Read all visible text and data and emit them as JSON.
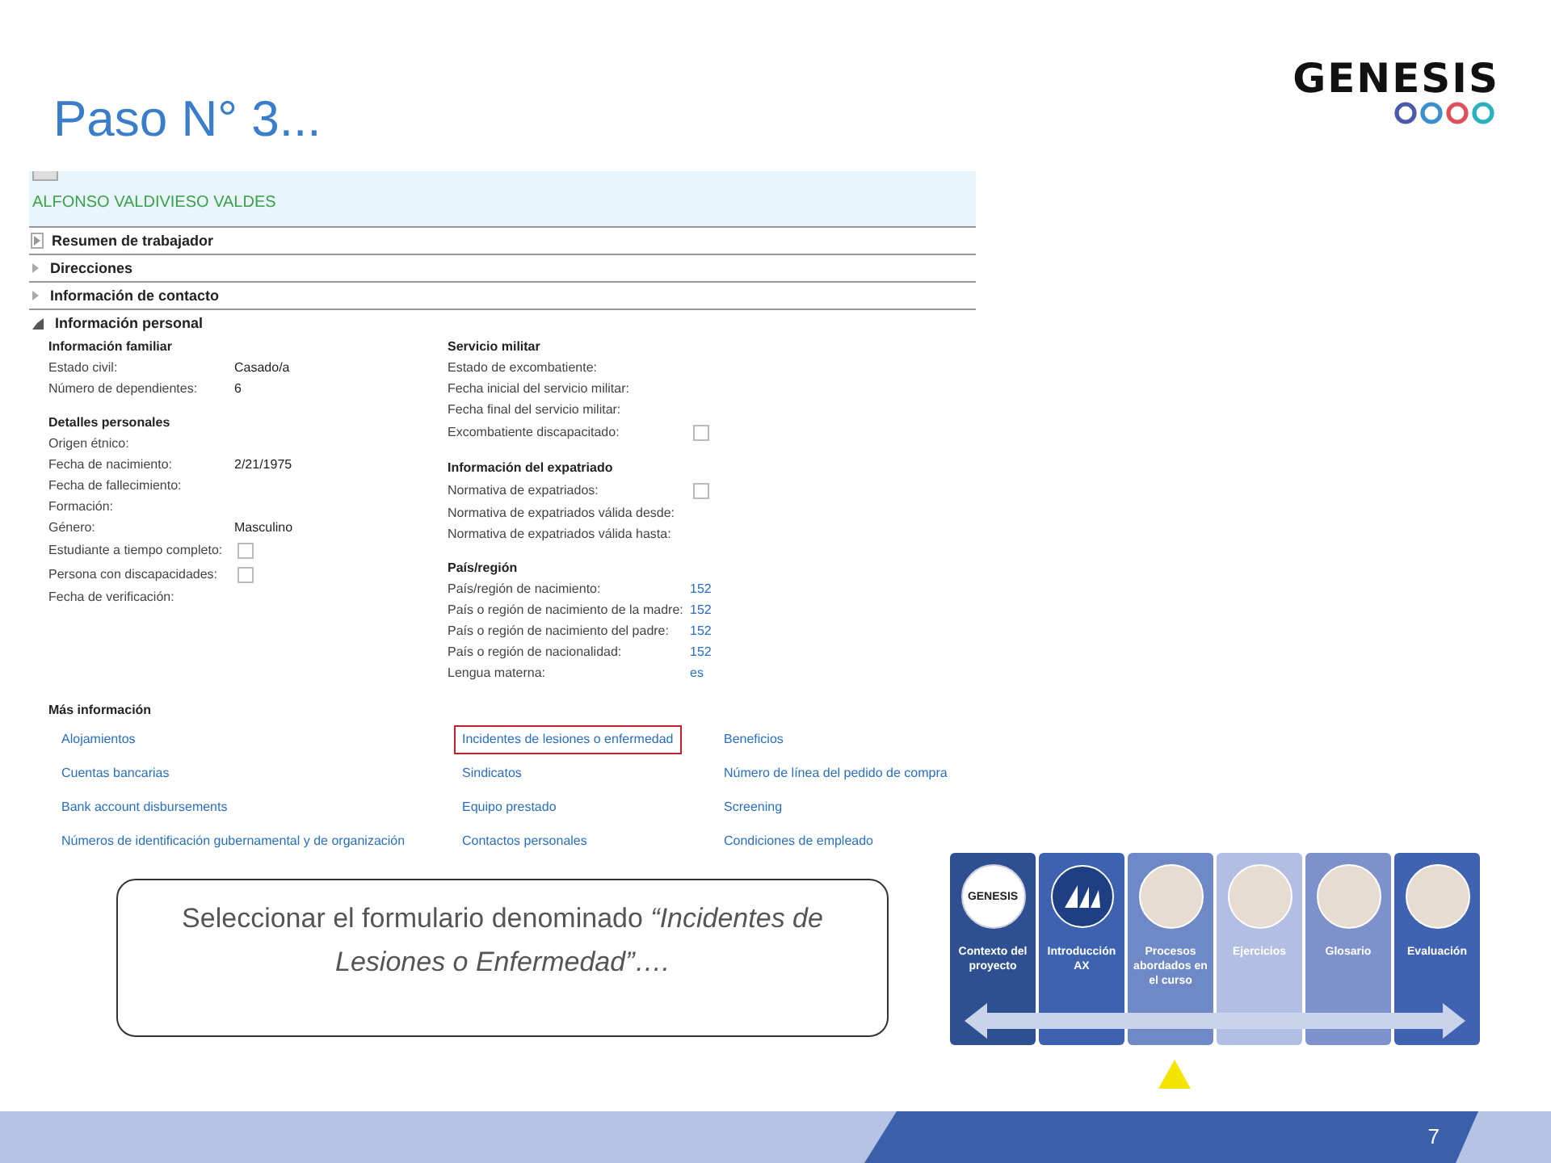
{
  "slide": {
    "title": "Paso N° 3...",
    "page_number": "7"
  },
  "logo": {
    "text": "GENESIS",
    "rings": [
      {
        "color": "#4a5aa8"
      },
      {
        "color": "#3a8fd0"
      },
      {
        "color": "#e0505a"
      },
      {
        "color": "#2ab0c0"
      }
    ]
  },
  "form": {
    "record_name": "ALFONSO VALDIVIESO VALDES",
    "sections": [
      {
        "label": "Resumen de trabajador",
        "kind": "preview",
        "expanded": false
      },
      {
        "label": "Direcciones",
        "kind": "fasttab",
        "expanded": false
      },
      {
        "label": "Información de contacto",
        "kind": "fasttab",
        "expanded": false
      },
      {
        "label": "Información personal",
        "kind": "fasttab",
        "expanded": true
      }
    ],
    "columns": [
      [
        {
          "heading": "Información familiar",
          "fields": [
            {
              "label": "Estado civil:",
              "kind": "text",
              "value": "Casado/a"
            },
            {
              "label": "Número de dependientes:",
              "kind": "text",
              "value": "6"
            }
          ]
        },
        {
          "heading": "Detalles personales",
          "fields": [
            {
              "label": "Origen étnico:",
              "kind": "text"
            },
            {
              "label": "Fecha de nacimiento:",
              "kind": "text",
              "value": "2/21/1975"
            },
            {
              "label": "Fecha de fallecimiento:",
              "kind": "text"
            },
            {
              "label": "Formación:",
              "kind": "text"
            },
            {
              "label": "Género:",
              "kind": "text",
              "value": "Masculino"
            },
            {
              "label": "Estudiante a tiempo completo:",
              "kind": "checkbox",
              "checked": false
            },
            {
              "label": "Persona con discapacidades:",
              "kind": "checkbox",
              "checked": false
            },
            {
              "label": "Fecha de verificación:",
              "kind": "text"
            }
          ]
        }
      ],
      [
        {
          "heading": "Servicio militar",
          "fields": [
            {
              "label": "Estado de excombatiente:",
              "kind": "text"
            },
            {
              "label": "Fecha inicial del servicio militar:",
              "kind": "text"
            },
            {
              "label": "Fecha final del servicio militar:",
              "kind": "text"
            },
            {
              "label": "Excombatiente discapacitado:",
              "kind": "checkbox",
              "checked": false
            }
          ]
        },
        {
          "heading": "Información del expatriado",
          "fields": [
            {
              "label": "Normativa de expatriados:",
              "kind": "checkbox",
              "checked": false
            },
            {
              "label": "Normativa de expatriados válida desde:",
              "kind": "text"
            },
            {
              "label": "Normativa de expatriados válida hasta:",
              "kind": "text"
            }
          ]
        },
        {
          "heading": "País/región",
          "fields": [
            {
              "label": "País/región de nacimiento:",
              "kind": "link",
              "value": "152"
            },
            {
              "label": "País o región de nacimiento de la madre:",
              "kind": "link",
              "value": "152"
            },
            {
              "label": "País o región de nacimiento del padre:",
              "kind": "link",
              "value": "152"
            },
            {
              "label": "País o región de nacionalidad:",
              "kind": "link",
              "value": "152"
            },
            {
              "label": "Lengua materna:",
              "kind": "link",
              "value": "es"
            }
          ]
        }
      ]
    ],
    "more_info": {
      "heading": "Más información",
      "link_columns": [
        [
          {
            "label": "Alojamientos",
            "highlighted": false
          },
          {
            "label": "Cuentas bancarias",
            "highlighted": false
          },
          {
            "label": "Bank account disbursements",
            "highlighted": false
          },
          {
            "label": "Números de identificación gubernamental y de organización",
            "highlighted": false
          }
        ],
        [
          {
            "label": "Incidentes de lesiones o enfermedad",
            "highlighted": true
          },
          {
            "label": "Sindicatos",
            "highlighted": false
          },
          {
            "label": "Equipo prestado",
            "highlighted": false
          },
          {
            "label": "Contactos personales",
            "highlighted": false
          }
        ],
        [
          {
            "label": "Beneficios",
            "highlighted": false
          },
          {
            "label": "Número de línea del pedido de compra",
            "highlighted": false
          },
          {
            "label": "Screening",
            "highlighted": false
          },
          {
            "label": "Condiciones de empleado",
            "highlighted": false
          }
        ]
      ]
    }
  },
  "callout": {
    "text": "Seleccionar el formulario denominado *“Incidentes de Lesiones o Enfermedad”….*"
  },
  "nav_tiles": [
    {
      "label": "Contexto del proyecto",
      "kind": "logo",
      "logo_text": "GENESIS",
      "color": "#2f5090"
    },
    {
      "label": "Introducción AX",
      "kind": "sail",
      "color": "#3d62b0"
    },
    {
      "label": "Procesos abordados en el curso",
      "kind": "photo",
      "color": "#6f88c6"
    },
    {
      "label": "Ejercicios",
      "kind": "photo",
      "color": "#b2bfe2"
    },
    {
      "label": "Glosario",
      "kind": "photo",
      "color": "#7d92cb"
    },
    {
      "label": "Evaluación",
      "kind": "photo",
      "color": "#3f63b0"
    }
  ]
}
